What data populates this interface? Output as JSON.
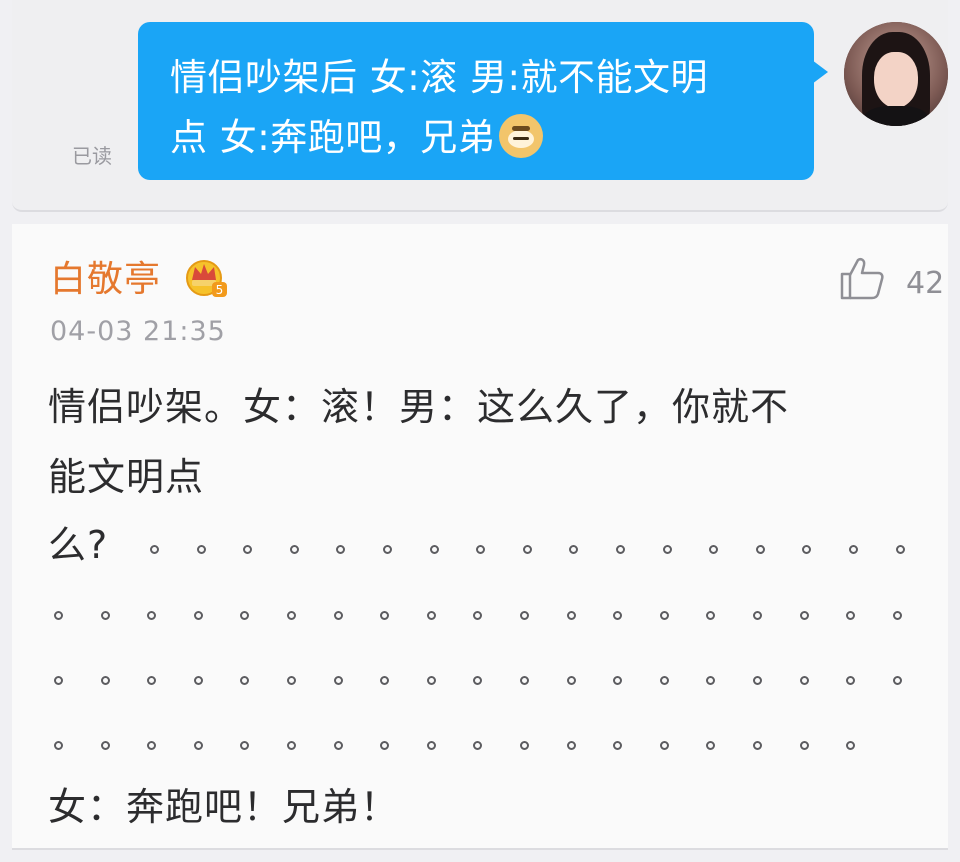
{
  "chat": {
    "read_status": "已读",
    "bubble_line1": "情侣吵架后 女:滚  男:就不能文明",
    "bubble_line2": "点  女:奔跑吧，兄弟",
    "avatar_icon": "user-avatar-icon",
    "bubble_color": "#1aa5f6"
  },
  "comment": {
    "username": "白敬亭",
    "username_color": "#e5782e",
    "badge_icon": "crown-vip-badge-icon",
    "badge_level": "5",
    "like_count": "42",
    "like_icon": "thumbs-up-icon",
    "timestamp": "04-03 21:35",
    "body_line1": "情侣吵架。女：滚！男：这么久了，你就不",
    "body_line2": "能文明点",
    "body_line3": "么?",
    "closing_line": "女：奔跑吧！兄弟！"
  }
}
